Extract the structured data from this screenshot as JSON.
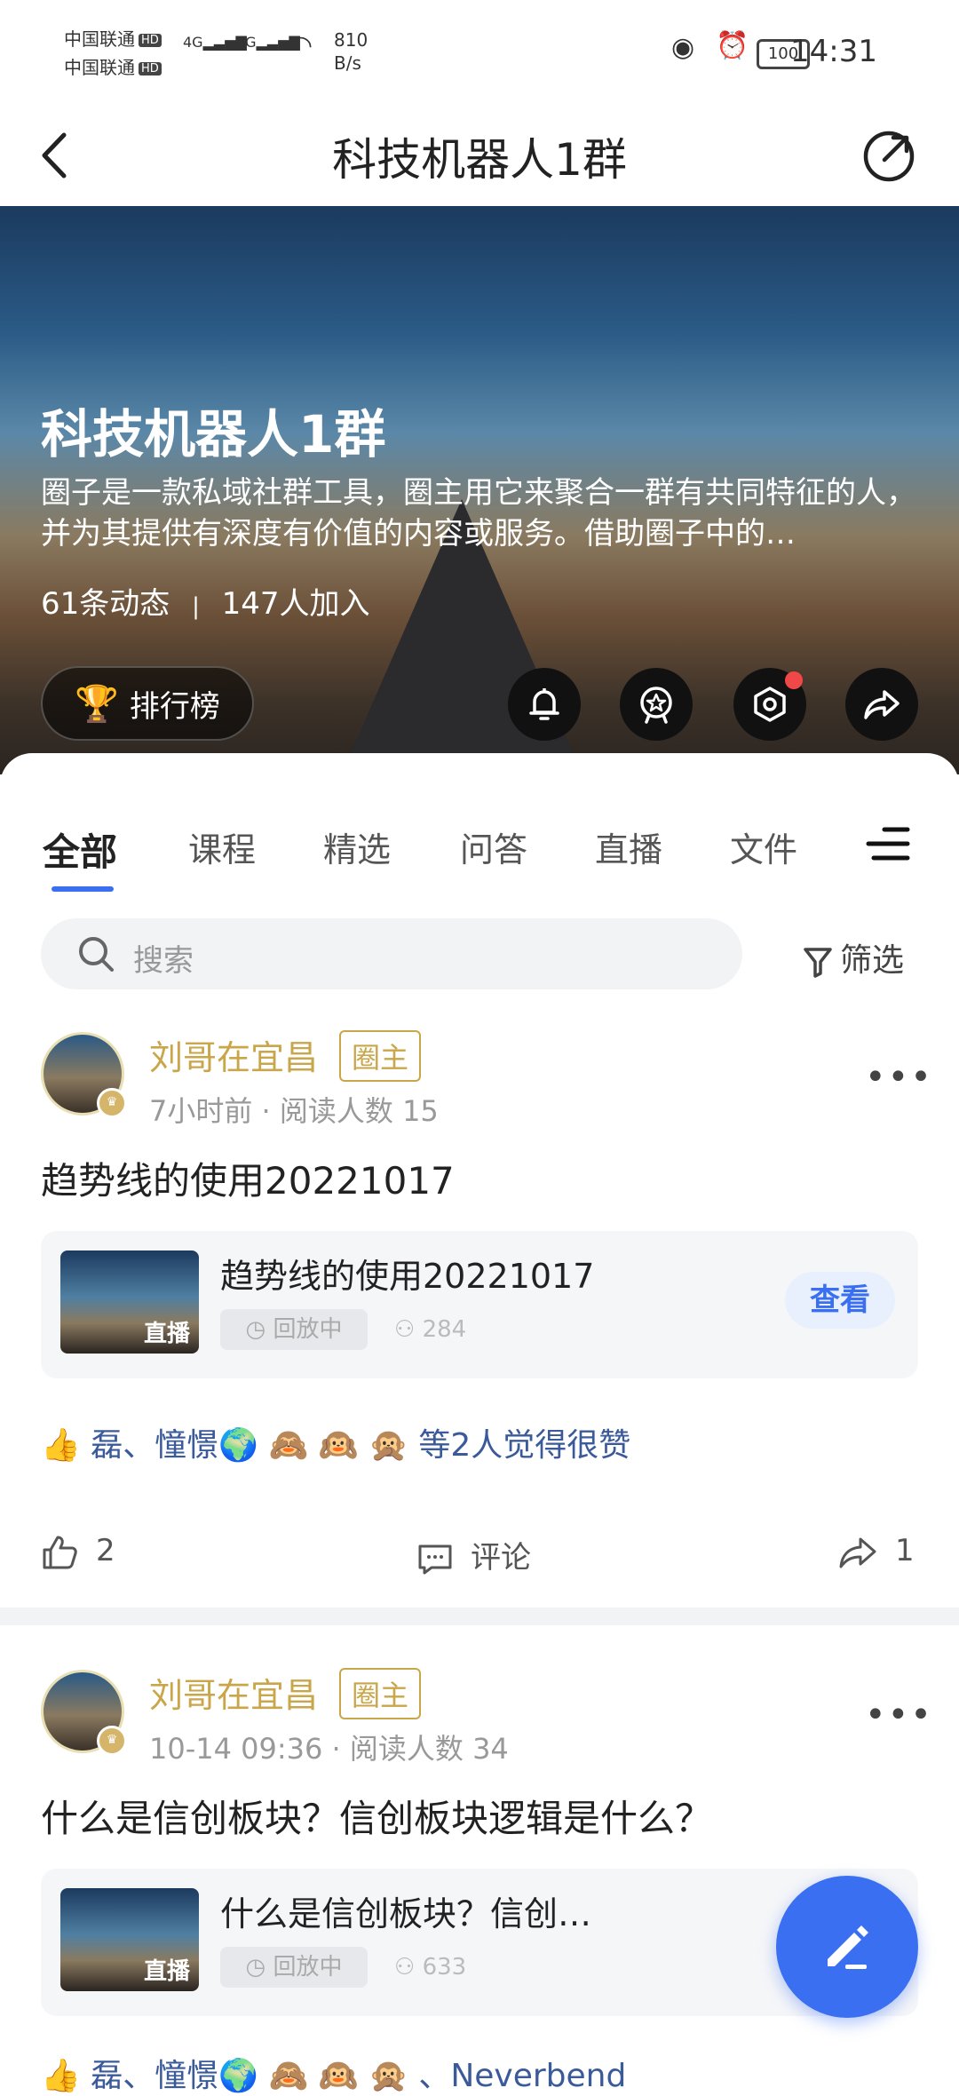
{
  "status_bar": {
    "carrier1": "中国联通",
    "carrier2": "中国联通",
    "hd": "HD",
    "net1": "4G",
    "net2": "4G",
    "speed_value": "810",
    "speed_unit": "B/s",
    "battery": "100",
    "time": "14:31"
  },
  "header": {
    "title": "科技机器人1群"
  },
  "hero": {
    "title": "科技机器人1群",
    "description": "圈子是一款私域社群工具，圈主用它来聚合一群有共同特征的人，并为其提供有深度有价值的内容或服务。借助圈子中的…",
    "posts_count": "61条动态",
    "members_count": "147人加入",
    "rank_label": "排行榜"
  },
  "tabs": [
    "全部",
    "课程",
    "精选",
    "问答",
    "直播",
    "文件"
  ],
  "search": {
    "placeholder": "搜索",
    "filter_label": "筛选"
  },
  "posts": [
    {
      "author": "刘哥在宜昌",
      "role": "圈主",
      "time": "7小时前",
      "reads": "阅读人数 15",
      "title": "趋势线的使用20221017",
      "card_title": "趋势线的使用20221017",
      "thumb_label": "直播",
      "status": "回放中",
      "viewers": "284",
      "view_label": "查看",
      "likers": "磊、憧憬🌍 🙈 🙉 🙊 等2人觉得很赞",
      "likes": "2",
      "comment_label": "评论",
      "shares": "1"
    },
    {
      "author": "刘哥在宜昌",
      "role": "圈主",
      "time": "10-14 09:36",
      "reads": "阅读人数 34",
      "title": "什么是信创板块？信创板块逻辑是什么？",
      "card_title": "什么是信创板块？信创…",
      "thumb_label": "直播",
      "status": "回放中",
      "viewers": "633",
      "likers": "磊、憧憬🌍 🙈 🙉 🙊 、Neverbend"
    }
  ],
  "icons": [
    "back-icon",
    "refresh-icon",
    "trophy-icon",
    "bell-icon",
    "badge-icon",
    "settings-icon",
    "share-icon",
    "menu-icon",
    "search-icon",
    "filter-icon",
    "more-icon",
    "history-icon",
    "people-icon",
    "thumb-up-icon",
    "comment-icon",
    "edit-icon"
  ],
  "colors": {
    "accent": "#3a6ff2",
    "owner_gold": "#c9a64a",
    "notification": "#f04848"
  }
}
